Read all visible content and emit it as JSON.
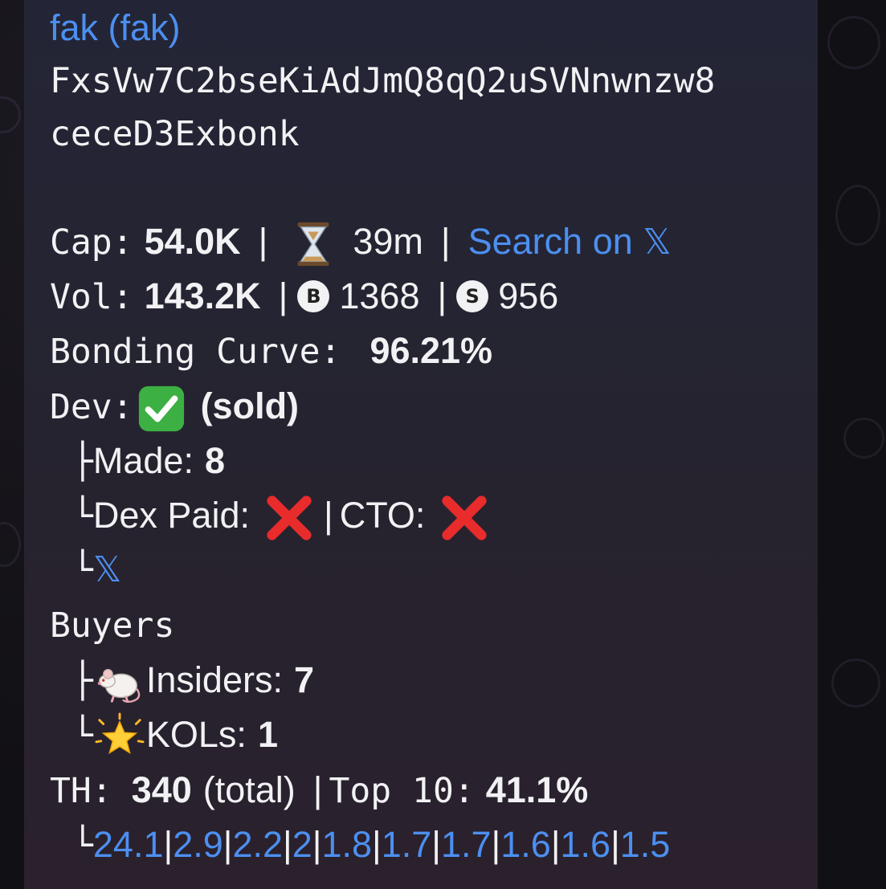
{
  "message": {
    "title": "fak (fak)",
    "address_line1": "FxsVw7C2bseKiAdJmQ8qQ2uSVNnwnzw8",
    "address_line2": "ceceD3Exbonk",
    "cap": {
      "label": "Cap:",
      "value": "54.0K",
      "sep": "|",
      "age": "39m",
      "sep2": "|",
      "search_label": "Search on",
      "x_symbol": "𝕏"
    },
    "vol": {
      "label": "Vol:",
      "value": "143.2K",
      "sep": "|",
      "buy_icon": "B",
      "buys": "1368",
      "sep2": "|",
      "sell_icon": "S",
      "sells": "956"
    },
    "bonding": {
      "label": "Bonding Curve:",
      "value": "96.21%"
    },
    "dev": {
      "label": "Dev:",
      "status": "(sold)",
      "made_prefix": "├",
      "made_label": "Made:",
      "made_value": "8",
      "dex_prefix": "└",
      "dex_label": "Dex Paid:",
      "sep": "|",
      "cto_label": "CTO:",
      "x_prefix": "└",
      "x_symbol": "𝕏"
    },
    "buyers": {
      "label": "Buyers",
      "insiders_prefix": "├",
      "insiders_label": "Insiders:",
      "insiders_value": "7",
      "kols_prefix": "└",
      "kols_label": "KOLs:",
      "kols_value": "1"
    },
    "holders": {
      "label": "TH:",
      "total": "340",
      "total_suffix": "(total)",
      "sep": "|",
      "top_label": "Top 10:",
      "top_value": "41.1%",
      "dist_prefix": "└",
      "distribution": [
        "24.1",
        "2.9",
        "2.2",
        "2",
        "1.8",
        "1.7",
        "1.7",
        "1.6",
        "1.6",
        "1.5"
      ]
    }
  },
  "colors": {
    "link": "#4c8ff0",
    "text": "#f2f2f4",
    "bubble": "#24243a",
    "cross": "#e82b2b",
    "check": "#3cb043"
  },
  "icons": [
    "hourglass-icon",
    "buy-circle-icon",
    "sell-circle-icon",
    "check-mark-icon",
    "cross-mark-icon",
    "rat-icon",
    "glowing-star-icon",
    "x-logo-icon"
  ]
}
